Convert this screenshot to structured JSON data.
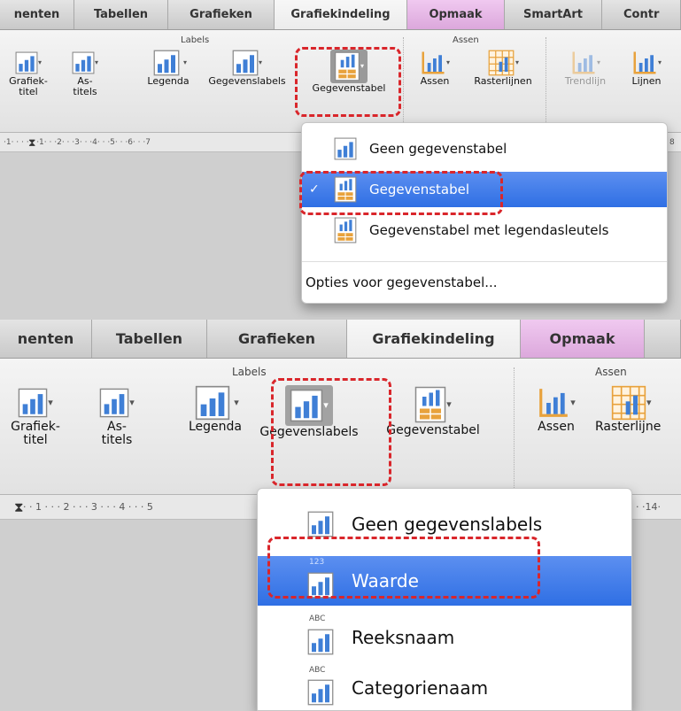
{
  "top": {
    "tabs": [
      {
        "label": "nenten"
      },
      {
        "label": "Tabellen"
      },
      {
        "label": "Grafieken"
      },
      {
        "label": "Grafiekindeling"
      },
      {
        "label": "Opmaak"
      },
      {
        "label": "SmartArt"
      },
      {
        "label": "Contr"
      }
    ],
    "group_labels": {
      "labels": "Labels",
      "assen": "Assen"
    },
    "buttons": {
      "grafiektitel": "Grafiek-\ntitel",
      "astitels": "As-\ntitels",
      "legenda": "Legenda",
      "gegevenslabels": "Gegevenslabels",
      "gegevenstabel": "Gegevenstabel",
      "assen": "Assen",
      "rasterlijnen": "Rasterlijnen",
      "trendlijn": "Trendlijn",
      "lijnen": "Lijnen"
    },
    "ruler": "·1· · ·  · · ·1· · ·2· · ·3· · ·4· · ·5· · ·6· · ·7",
    "ruler_right": "8",
    "menu": {
      "items": [
        {
          "label": "Geen gegevenstabel",
          "icon": "chart-no-table-icon"
        },
        {
          "label": "Gegevenstabel",
          "icon": "chart-data-table-icon",
          "checked": true
        },
        {
          "label": "Gegevenstabel met legendasleutels",
          "icon": "chart-data-table-legend-icon"
        }
      ],
      "options": "Opties voor gegevenstabel..."
    }
  },
  "bottom": {
    "tabs": [
      {
        "label": "nenten"
      },
      {
        "label": "Tabellen"
      },
      {
        "label": "Grafieken"
      },
      {
        "label": "Grafiekindeling"
      },
      {
        "label": "Opmaak"
      }
    ],
    "group_labels": {
      "labels": "Labels",
      "assen": "Assen"
    },
    "buttons": {
      "grafiektitel": "Grafiek-\ntitel",
      "astitels": "As-\ntitels",
      "legenda": "Legenda",
      "gegevenslabels": "Gegevenslabels",
      "gegevenstabel": "Gegevenstabel",
      "assen": "Assen",
      "rasterlijnen": "Rasterlijne"
    },
    "ruler": "· · 1 · · · 2 · · · 3 · · · 4 · · · 5",
    "ruler_right": "· ·14·",
    "menu": {
      "items": [
        {
          "label": "Geen gegevenslabels",
          "icon": "chart-no-labels-icon"
        },
        {
          "label": "Waarde",
          "icon": "chart-value-labels-icon",
          "sublabel": "123",
          "selected": true
        },
        {
          "label": "Reeksnaam",
          "icon": "chart-series-name-icon",
          "sublabel": "ABC"
        },
        {
          "label": "Categorienaam",
          "icon": "chart-category-name-icon",
          "sublabel": "ABC"
        }
      ]
    }
  },
  "colors": {
    "selection": "#3a78e8",
    "highlight_dash": "#d9262b",
    "icon_blue": "#3f7fd6",
    "icon_orange": "#e8a23c"
  }
}
